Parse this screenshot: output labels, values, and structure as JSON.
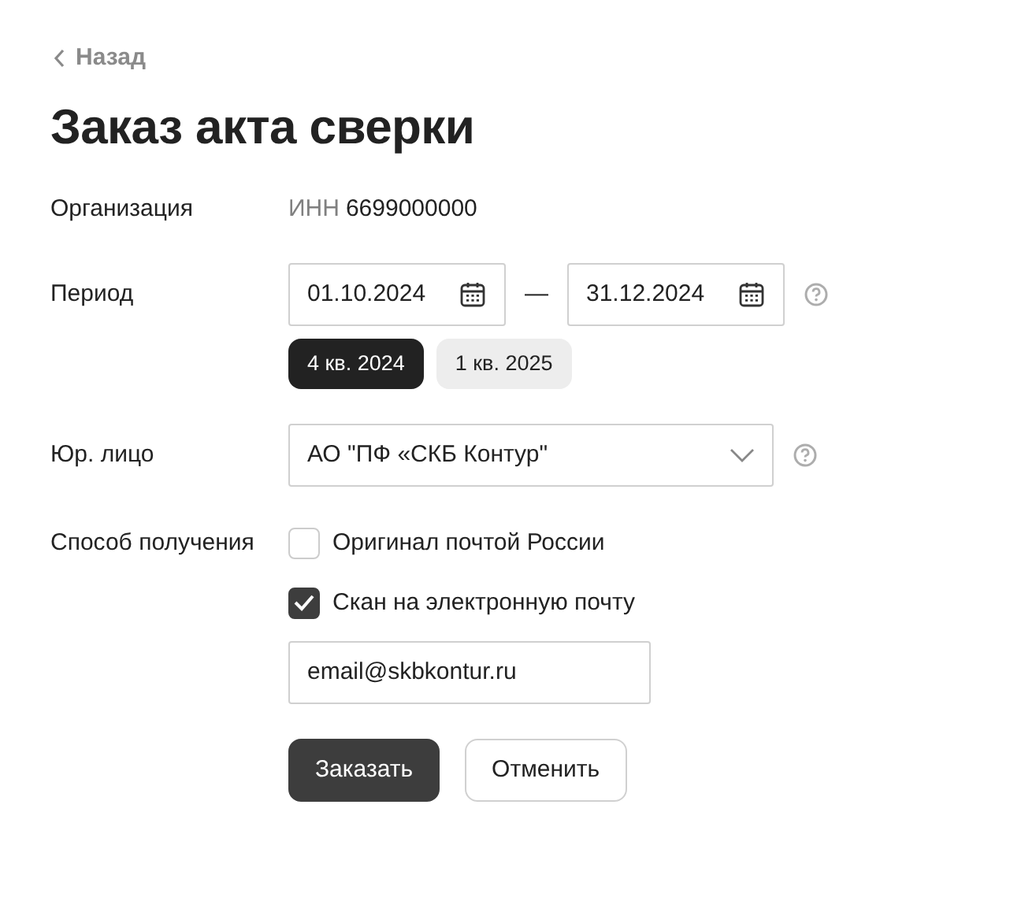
{
  "back_link": {
    "label": "Назад"
  },
  "title": "Заказ акта сверки",
  "fields": [
    {
      "kind": "text",
      "label": "Организация",
      "prefix": "ИНН",
      "value": "6699000000",
      "help": false
    },
    {
      "kind": "period",
      "label": "Период",
      "from": "01.10.2024",
      "separator": "—",
      "to": "31.12.2024",
      "help": true,
      "quarters": [
        {
          "label": "4 кв. 2024",
          "selected": true
        },
        {
          "label": "1 кв. 2025",
          "selected": false
        }
      ]
    },
    {
      "kind": "select",
      "label": "Юр. лицо",
      "value": "АО \"ПФ «СКБ Контур\"",
      "help": true
    },
    {
      "kind": "delivery",
      "label": "Способ получения",
      "help": false,
      "options": [
        {
          "label": "Оригинал почтой России",
          "checked": false
        },
        {
          "label": "Скан на электронную почту",
          "checked": true
        }
      ],
      "email": "email@skbkontur.ru"
    }
  ],
  "buttons": [
    {
      "label": "Заказать",
      "kind": "primary"
    },
    {
      "label": "Отменить",
      "kind": "secondary"
    }
  ]
}
